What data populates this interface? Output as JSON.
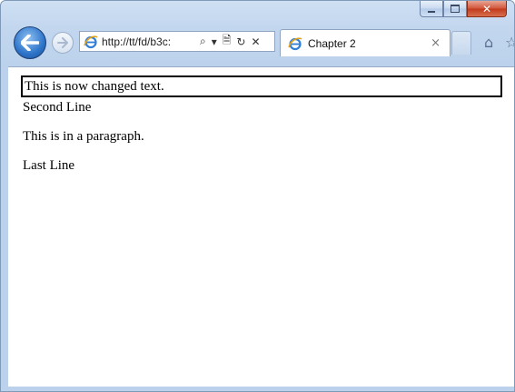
{
  "window": {
    "caption_buttons": [
      "minimize",
      "maximize",
      "close"
    ]
  },
  "toolbar": {
    "back_icon": "back-arrow-icon",
    "forward_icon": "forward-arrow-icon",
    "address": {
      "url": "http://tt/fd/b3c:",
      "search_glyph": "⌕",
      "dropdown_glyph": "▾",
      "compat_glyph": "🗎",
      "refresh_glyph": "↻",
      "stop_glyph": "✕"
    },
    "tab": {
      "title": "Chapter 2",
      "close_glyph": "×"
    },
    "home_glyph": "⌂",
    "favorites_glyph": "☆"
  },
  "page": {
    "changed_text": "This is now changed text.",
    "second_line": "Second Line",
    "paragraph": "This is in a paragraph.",
    "last_line": "Last Line"
  },
  "colors": {
    "frame": "#bcd2ec",
    "close_button": "#c2391c",
    "back_button": "#2d74c9"
  }
}
